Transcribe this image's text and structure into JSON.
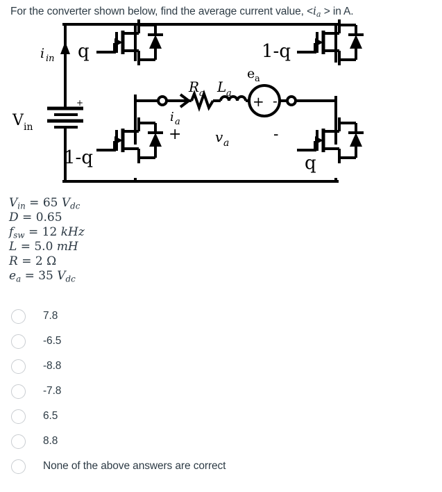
{
  "question": {
    "stem_before": "For the converter shown below, find the average current value, <",
    "stem_symbol": "i",
    "stem_symbol_sub": "a",
    "stem_after": "> in A."
  },
  "circuit": {
    "title": "full-bridge-h-bridge-converter",
    "labels": {
      "i_in": "i",
      "i_in_sub": "in",
      "v_in": "V",
      "v_in_sub": "in",
      "source_plus": "+",
      "q_top_left": "q",
      "q_bottom_left": "1-q",
      "q_top_right": "1-q",
      "q_bottom_right": "q",
      "R_a": "R",
      "R_a_sub": "a",
      "L_a": "L",
      "L_a_sub": "a",
      "e_a": "e",
      "e_a_sub": "a",
      "i_a": "i",
      "i_a_sub": "a",
      "v_a": "v",
      "v_a_sub": "a",
      "branch_plus": "+",
      "branch_minus": "-",
      "source_sym_plus": "+",
      "source_sym_minus": "-"
    }
  },
  "parameters": [
    {
      "symbol": "V",
      "sub": "in",
      "value": "65",
      "unit": "V",
      "unit_sub": "dc"
    },
    {
      "symbol": "D",
      "sub": "",
      "value": "0.65",
      "unit": "",
      "unit_sub": ""
    },
    {
      "symbol": "f",
      "sub": "sw",
      "value": "12",
      "unit": "kHz",
      "unit_sub": ""
    },
    {
      "symbol": "L",
      "sub": "",
      "value": "5.0",
      "unit": "mH",
      "unit_sub": ""
    },
    {
      "symbol": "R",
      "sub": "",
      "value": "2",
      "unit": "Ω",
      "unit_sub": ""
    },
    {
      "symbol": "e",
      "sub": "a",
      "value": "35",
      "unit": "V",
      "unit_sub": "dc"
    }
  ],
  "options": [
    {
      "label": "7.8",
      "selected": false
    },
    {
      "label": "-6.5",
      "selected": false
    },
    {
      "label": "-8.8",
      "selected": false
    },
    {
      "label": "-7.8",
      "selected": false
    },
    {
      "label": "6.5",
      "selected": false
    },
    {
      "label": "8.8",
      "selected": false
    },
    {
      "label": "None of the above answers are correct",
      "selected": false
    }
  ],
  "colors": {
    "text": "#2d3b45",
    "radio_border": "#c9cdd1",
    "wire": "#000000",
    "background": "#ffffff"
  }
}
